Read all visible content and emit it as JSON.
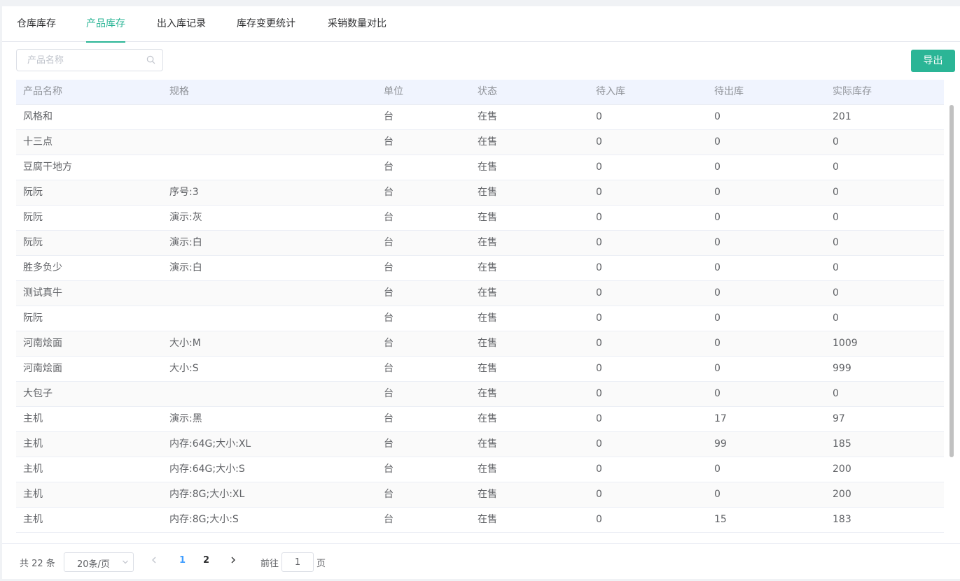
{
  "tabs": [
    {
      "label": "仓库库存",
      "active": false
    },
    {
      "label": "产品库存",
      "active": true
    },
    {
      "label": "出入库记录",
      "active": false
    },
    {
      "label": "库存变更统计",
      "active": false
    },
    {
      "label": "采销数量对比",
      "active": false
    }
  ],
  "search": {
    "placeholder": "产品名称",
    "value": ""
  },
  "toolbar": {
    "export_label": "导出"
  },
  "table": {
    "columns": [
      "产品名称",
      "规格",
      "单位",
      "状态",
      "待入库",
      "待出库",
      "实际库存"
    ],
    "rows": [
      [
        "风格和",
        "",
        "台",
        "在售",
        "0",
        "0",
        "201"
      ],
      [
        "十三点",
        "",
        "台",
        "在售",
        "0",
        "0",
        "0"
      ],
      [
        "豆腐干地方",
        "",
        "台",
        "在售",
        "0",
        "0",
        "0"
      ],
      [
        "阮阮",
        "序号:3",
        "台",
        "在售",
        "0",
        "0",
        "0"
      ],
      [
        "阮阮",
        "演示:灰",
        "台",
        "在售",
        "0",
        "0",
        "0"
      ],
      [
        "阮阮",
        "演示:白",
        "台",
        "在售",
        "0",
        "0",
        "0"
      ],
      [
        "胜多负少",
        "演示:白",
        "台",
        "在售",
        "0",
        "0",
        "0"
      ],
      [
        "测试真牛",
        "",
        "台",
        "在售",
        "0",
        "0",
        "0"
      ],
      [
        "阮阮",
        "",
        "台",
        "在售",
        "0",
        "0",
        "0"
      ],
      [
        "河南烩面",
        "大小:M",
        "台",
        "在售",
        "0",
        "0",
        "1009"
      ],
      [
        "河南烩面",
        "大小:S",
        "台",
        "在售",
        "0",
        "0",
        "999"
      ],
      [
        "大包子",
        "",
        "台",
        "在售",
        "0",
        "0",
        "0"
      ],
      [
        "主机",
        "演示:黑",
        "台",
        "在售",
        "0",
        "17",
        "97"
      ],
      [
        "主机",
        "内存:64G;大小:XL",
        "台",
        "在售",
        "0",
        "99",
        "185"
      ],
      [
        "主机",
        "内存:64G;大小:S",
        "台",
        "在售",
        "0",
        "0",
        "200"
      ],
      [
        "主机",
        "内存:8G;大小:XL",
        "台",
        "在售",
        "0",
        "0",
        "200"
      ],
      [
        "主机",
        "内存:8G;大小:S",
        "台",
        "在售",
        "0",
        "15",
        "183"
      ]
    ]
  },
  "pagination": {
    "total_label": "共 22 条",
    "page_size_label": "20条/页",
    "pages": [
      "1",
      "2"
    ],
    "current_page": "1",
    "goto_prefix": "前往",
    "goto_value": "1",
    "goto_suffix": "页"
  },
  "colors": {
    "accent": "#2bb596",
    "page_current": "#409eff",
    "header_bg": "#f0f4fe"
  },
  "icons": {
    "search": "search-icon",
    "select": "chevron-down-icon",
    "prev": "chevron-left-icon",
    "next": "chevron-right-icon"
  }
}
